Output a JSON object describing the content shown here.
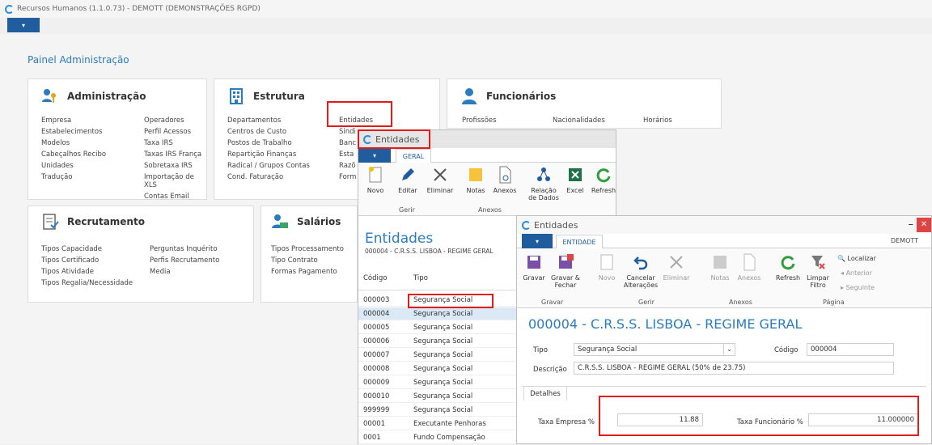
{
  "app": {
    "title": "Recursos Humanos (1.1.0.73) - DEMOTT (DEMONSTRAÇÕES RGPD)",
    "menu_label": "▾"
  },
  "panel": {
    "title": "Painel Administração",
    "administracao": {
      "title": "Administração",
      "col1": [
        "Empresa",
        "Estabelecimentos",
        "Modelos",
        "Cabeçalhos Recibo",
        "Unidades",
        "Tradução"
      ],
      "col2": [
        "Operadores",
        "Perfil Acessos",
        "Taxa IRS",
        "Taxas IRS França",
        "Sobretaxa IRS",
        "Importação de XLS",
        "Contas Email"
      ]
    },
    "estrutura": {
      "title": "Estrutura",
      "col1": [
        "Departamentos",
        "Centros de Custo",
        "Postos de Trabalho",
        "Repartição Finanças",
        "Radical / Grupos Contas",
        "Cond. Faturação"
      ],
      "col2": [
        "Entidades",
        "Sindi",
        "Banc",
        "Esta",
        "Razõ",
        "Form"
      ]
    },
    "funcionarios": {
      "title": "Funcionários",
      "col1": [
        "Profissões"
      ],
      "col2": [
        "Nacionalidades"
      ],
      "col3": [
        "Horários"
      ]
    },
    "recrutamento": {
      "title": "Recrutamento",
      "col1": [
        "Tipos Capacidade",
        "Tipos Certificado",
        "Tipos Atividade",
        "Tipos Regalia/Necessidade"
      ],
      "col2": [
        "Perguntas Inquérito",
        "Perfis Recrutamento",
        "Media"
      ]
    },
    "salarios": {
      "title": "Salários",
      "col1": [
        "Tipos Processamento",
        "Tipo Contrato",
        "Formas Pagamento"
      ]
    }
  },
  "entidades_list": {
    "window_title": "Entidades",
    "tab": "GERAL",
    "buttons": {
      "novo": "Novo",
      "editar": "Editar",
      "eliminar": "Eliminar",
      "notas": "Notas",
      "anexos": "Anexos",
      "relacao": "Relação de Dados",
      "excel": "Excel",
      "refresh": "Refresh"
    },
    "groups": {
      "gerir": "Gerir",
      "anexos": "Anexos"
    },
    "heading": "Entidades",
    "subheading": "000004 - C.R.S.S. LISBOA - REGIME GERAL",
    "col_codigo": "Código",
    "col_tipo": "Tipo",
    "rows": [
      {
        "codigo": "000003",
        "tipo": "Segurança Social"
      },
      {
        "codigo": "000004",
        "tipo": "Segurança Social"
      },
      {
        "codigo": "000005",
        "tipo": "Segurança Social"
      },
      {
        "codigo": "000006",
        "tipo": "Segurança Social"
      },
      {
        "codigo": "000007",
        "tipo": "Segurança Social"
      },
      {
        "codigo": "000008",
        "tipo": "Segurança Social"
      },
      {
        "codigo": "000009",
        "tipo": "Segurança Social"
      },
      {
        "codigo": "000010",
        "tipo": "Segurança Social"
      },
      {
        "codigo": "999999",
        "tipo": "Segurança Social"
      },
      {
        "codigo": "00001",
        "tipo": "Executante Penhoras"
      },
      {
        "codigo": "0001",
        "tipo": "Fundo Compensação"
      }
    ]
  },
  "entidade_edit": {
    "window_title": "Entidades",
    "tab": "ENTIDADE",
    "user": "DEMOTT",
    "close": "✕",
    "minimize": "–",
    "buttons": {
      "gravar": "Gravar",
      "gravar_fechar": "Gravar & Fechar",
      "novo": "Novo",
      "cancelar": "Cancelar Alterações",
      "eliminar": "Eliminar",
      "notas": "Notas",
      "anexos": "Anexos",
      "refresh": "Refresh",
      "limpar": "Limpar Filtro",
      "localizar": "Localizar",
      "anterior": "Anterior",
      "seguinte": "Seguinte"
    },
    "groups": {
      "gravar": "Gravar",
      "gerir": "Gerir",
      "anexos": "Anexos",
      "pagina": "Página"
    },
    "heading": "000004 - C.R.S.S. LISBOA - REGIME GERAL",
    "tipo_label": "Tipo",
    "tipo_value": "Segurança Social",
    "codigo_label": "Código",
    "codigo_value": "000004",
    "descricao_label": "Descrição",
    "descricao_value": "C.R.S.S. LISBOA - REGIME GERAL (50% de 23.75)",
    "detalhes_tab": "Detalhes",
    "taxa_empresa_label": "Taxa Empresa %",
    "taxa_empresa_value": "11.88",
    "taxa_funcionario_label": "Taxa Funcionário %",
    "taxa_funcionario_value": "11.000000"
  }
}
